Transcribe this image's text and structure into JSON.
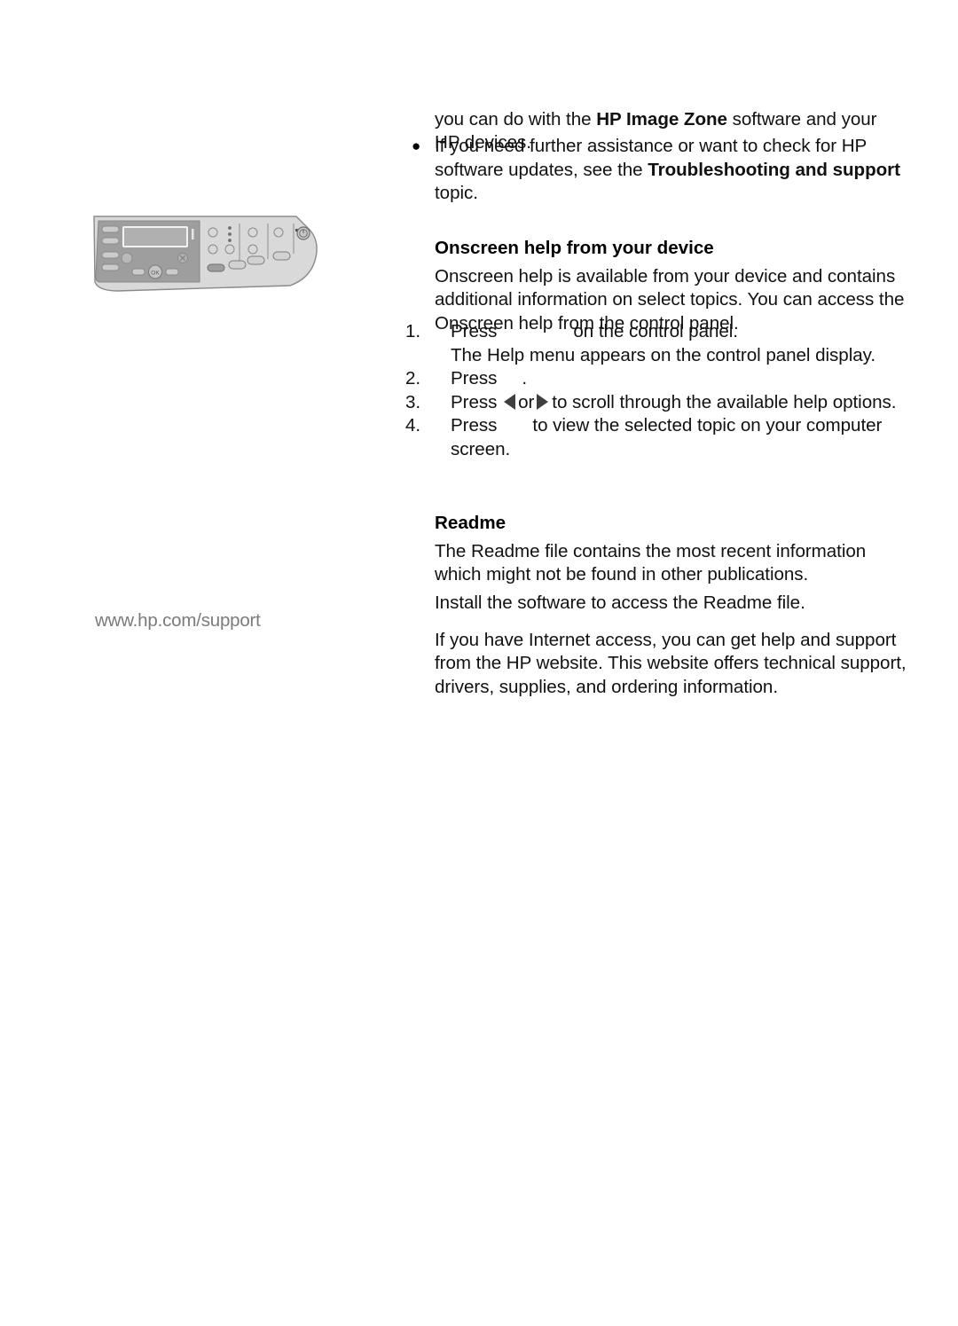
{
  "page": {
    "document_type": "printer user guide page",
    "margin": {
      "support_url": "www.hp.com/support",
      "figure_name": "control panel illustration"
    },
    "continued_paragraph": {
      "text_before_bold": "you can do with the ",
      "bold": "HP Image Zone",
      "text_after_bold": " software and your HP devices."
    },
    "bullets": [
      {
        "marker": "●",
        "text_before_bold": "If you need further assistance or want to check for HP software updates, see the ",
        "bold": "Troubleshooting and support",
        "text_after_bold": " topic."
      }
    ],
    "section_onscreen": {
      "heading": "Onscreen help from your device",
      "paragraph": "Onscreen help is available from your device and contains additional information on select topics. You can access the Onscreen help from the control panel.",
      "steps": [
        {
          "number": "1.",
          "text_before_icon": "Press",
          "icon": "setup-button-icon",
          "text_after_icon": "on the control panel.",
          "sub_text": "The Help menu appears on the control panel display."
        },
        {
          "number": "2.",
          "text_before_icon": "Press",
          "icon": "ok-button-icon",
          "text_after_icon": ".",
          "sub_text": ""
        },
        {
          "number": "3.",
          "text_before_icon": "Press",
          "arrow_left": "◀",
          "conjunction": "or",
          "arrow_right": "▶",
          "text_after_icon": "to scroll through the available help options.",
          "sub_text": ""
        },
        {
          "number": "4.",
          "text_before_icon": "Press",
          "icon": "ok-button-icon",
          "text_after_icon": "to view the selected topic on your computer screen.",
          "sub_text": ""
        }
      ]
    },
    "section_readme": {
      "heading": "Readme",
      "paragraph_1": "The Readme file contains the most recent information which might not be found in other publications.",
      "paragraph_2": "Install the software to access the Readme file."
    },
    "section_website": {
      "paragraph": "If you have Internet access, you can get help and support from the HP website. This website offers technical support, drivers, supplies, and ordering information."
    },
    "colors": {
      "body_text": "#111111",
      "margin_text": "#7b7b7b",
      "arrow_glyph": "#3f3f3f",
      "panel_light": "#d9d9d9",
      "panel_mid": "#bdbdbd",
      "panel_dark": "#9a9a9a",
      "panel_outline": "#8a8a8a",
      "page_background": "#ffffff"
    },
    "control_panel": {
      "display_label": "lcd-display",
      "buttons": [
        "side-button-1",
        "side-button-2",
        "side-button-3",
        "side-button-4",
        "ok-button",
        "cancel-button",
        "left-arrow-button",
        "right-arrow-button",
        "scan-button",
        "copy-button",
        "fax-button",
        "photo-button",
        "power-button"
      ],
      "ok_label": "OK"
    }
  }
}
